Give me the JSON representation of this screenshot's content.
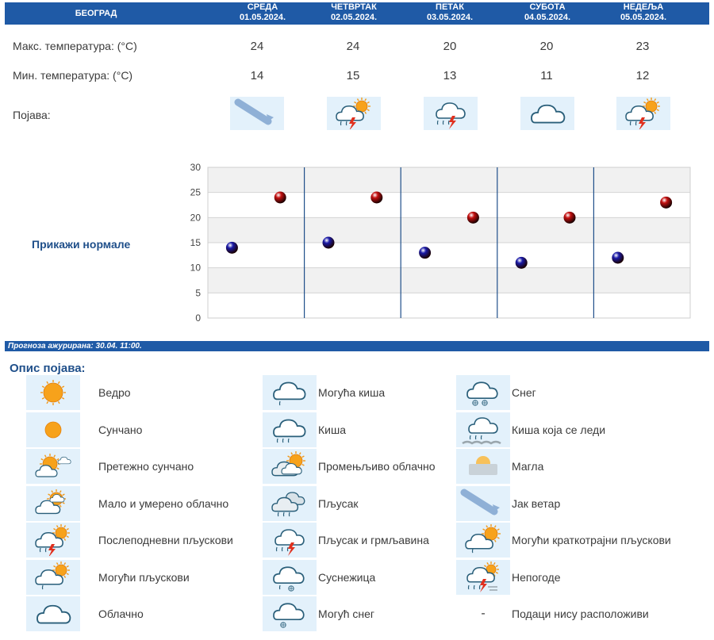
{
  "header": {
    "city": "БЕОГРАД",
    "days": [
      {
        "name": "СРЕДА",
        "date": "01.05.2024."
      },
      {
        "name": "ЧЕТВРТАК",
        "date": "02.05.2024."
      },
      {
        "name": "ПЕТАК",
        "date": "03.05.2024."
      },
      {
        "name": "СУБОТА",
        "date": "04.05.2024."
      },
      {
        "name": "НЕДЕЉА",
        "date": "05.05.2024."
      }
    ]
  },
  "rows": {
    "max_label": "Макс. температура: (°C)",
    "min_label": "Мин. температура: (°C)",
    "phenomenon_label": "Појава:",
    "max": [
      "24",
      "24",
      "20",
      "20",
      "23"
    ],
    "min": [
      "14",
      "15",
      "13",
      "11",
      "12"
    ],
    "icons": [
      "wind-icon",
      "afternoon-showers-icon",
      "showers-thunder-icon",
      "cloudy-icon",
      "afternoon-showers-icon"
    ]
  },
  "normals_link": "Прикажи нормале",
  "chart_data": {
    "type": "scatter",
    "categories": [
      "01.05.2024.",
      "02.05.2024.",
      "03.05.2024.",
      "04.05.2024.",
      "05.05.2024."
    ],
    "series": [
      {
        "values": [
          14,
          15,
          13,
          11,
          12
        ],
        "color": "#1a1aa8"
      },
      {
        "values": [
          24,
          24,
          20,
          20,
          23
        ],
        "color": "#c41010"
      }
    ],
    "ylim": [
      0,
      30
    ],
    "yticks": [
      "0",
      "5",
      "10",
      "15",
      "20",
      "25",
      "30"
    ],
    "grid": true
  },
  "updated": "Прогноза ажурирана:  30.04. 11:00.",
  "legend": {
    "title": "Опис појава:",
    "items": [
      {
        "icon": "clear-icon",
        "label": "Ведро"
      },
      {
        "icon": "sunny-icon",
        "label": "Сунчано"
      },
      {
        "icon": "mostly-sunny-icon",
        "label": "Претежно сунчано"
      },
      {
        "icon": "partly-cloudy-icon",
        "label": "Мало и умерено облачно"
      },
      {
        "icon": "afternoon-showers-icon",
        "label": "Послеподневни пљускови"
      },
      {
        "icon": "possible-showers-icon",
        "label": "Могући пљускови"
      },
      {
        "icon": "cloudy-icon",
        "label": "Облачно"
      },
      {
        "icon": "possible-rain-icon",
        "label": "Могућа киша"
      },
      {
        "icon": "rain-icon",
        "label": "Киша"
      },
      {
        "icon": "variable-cloudy-icon",
        "label": "Промењљиво облачно"
      },
      {
        "icon": "shower-icon",
        "label": "Пљусак"
      },
      {
        "icon": "showers-thunder-icon",
        "label": "Пљусак и грмљавина"
      },
      {
        "icon": "sleet-icon",
        "label": "Суснежица"
      },
      {
        "icon": "possible-snow-icon",
        "label": "Могућ снег"
      },
      {
        "icon": "snow-icon",
        "label": "Снег"
      },
      {
        "icon": "freezing-rain-icon",
        "label": "Киша која се леди"
      },
      {
        "icon": "fog-icon",
        "label": "Магла"
      },
      {
        "icon": "wind-icon",
        "label": "Јак ветар"
      },
      {
        "icon": "short-showers-icon",
        "label": "Могући краткотрајни пљускови"
      },
      {
        "icon": "storm-icon",
        "label": "Непогоде"
      },
      {
        "icon": "no-data-icon",
        "symbol": "-",
        "label": "Подаци нису расположиви"
      }
    ]
  }
}
